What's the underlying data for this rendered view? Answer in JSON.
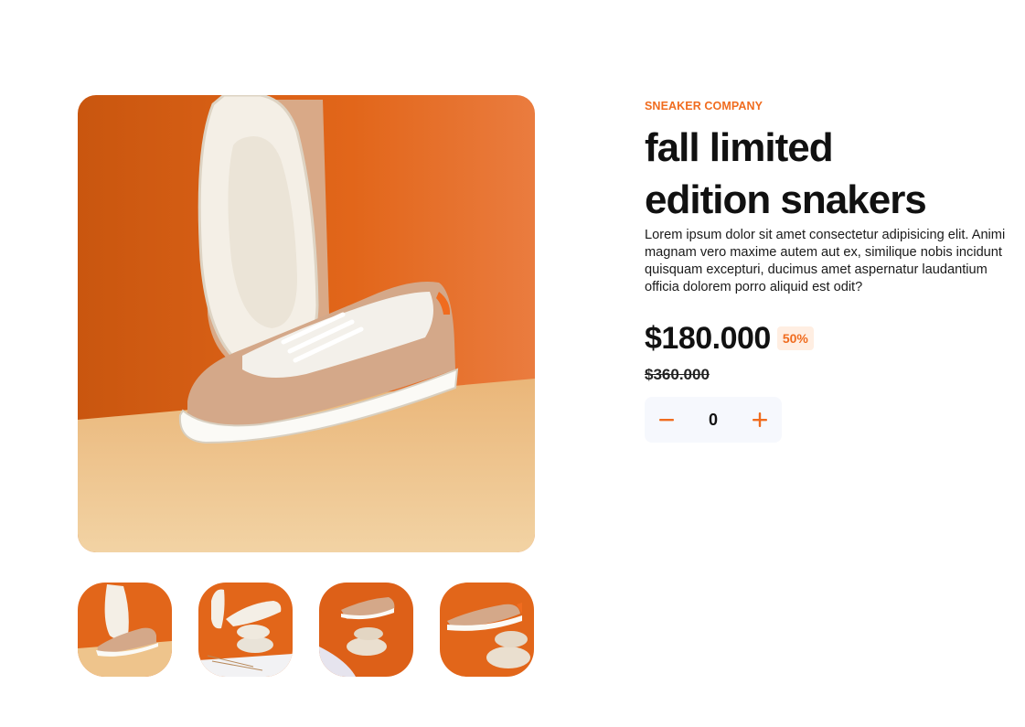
{
  "product": {
    "company": "Sneaker Company",
    "title_line1": "fall limited",
    "title_line2": "edition snakers",
    "description": "Lorem ipsum dolor sit amet consectetur adipisicing elit. Animi magnam vero maxime autem aut ex, similique nobis incidunt quisquam excepturi, ducimus amet aspernatur laudantium officia dolorem porro aliquid est odit?",
    "price": "$180.000",
    "discount": "50%",
    "old_price": "$360.000"
  },
  "quantity": {
    "value": "0",
    "decrement_icon": "minus-icon",
    "increment_icon": "plus-icon"
  },
  "gallery": {
    "thumbnail_count": 4
  },
  "colors": {
    "accent": "#f06c1f",
    "badge_bg": "#ffeee2",
    "stepper_bg": "#f6f8fd",
    "backdrop_orange": "#e2661a",
    "backdrop_floor": "#eec48c"
  }
}
